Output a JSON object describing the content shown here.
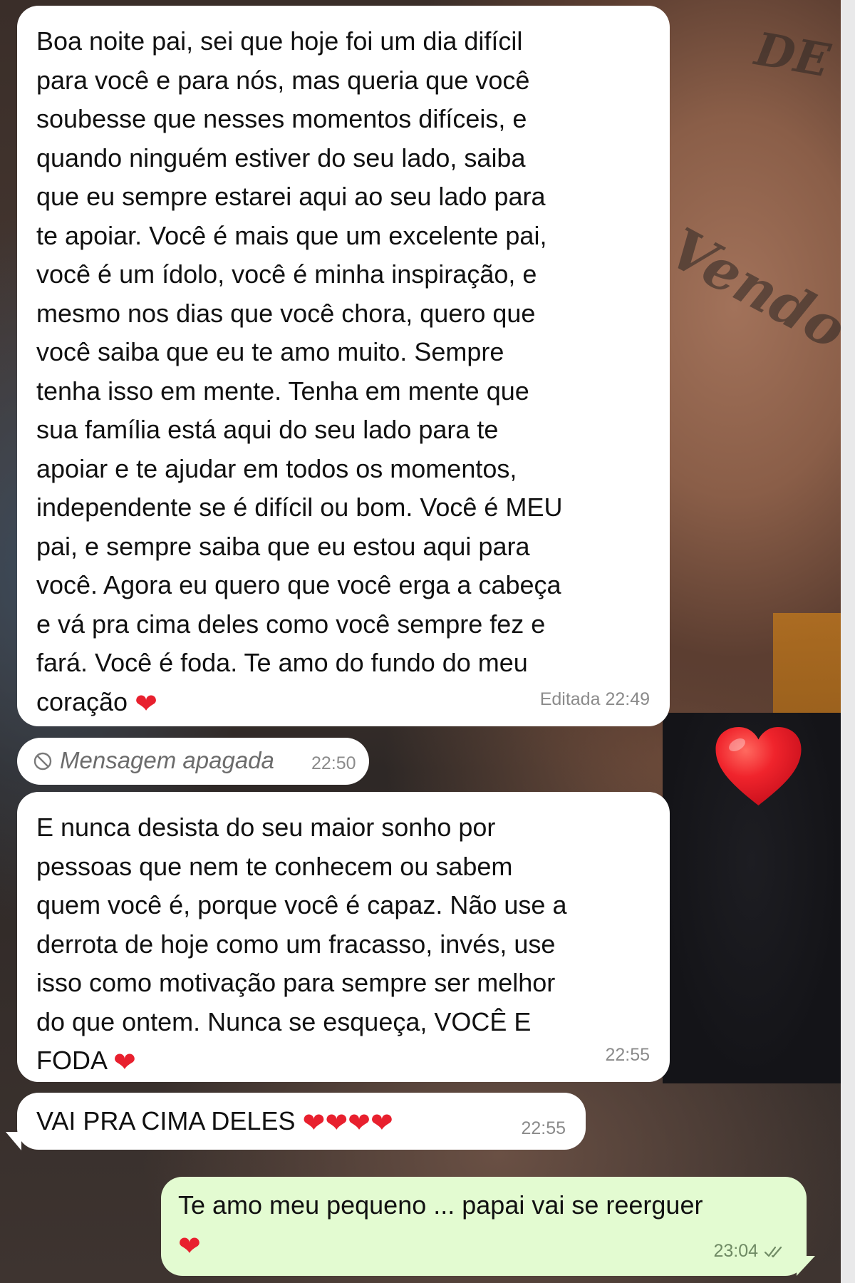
{
  "messages": [
    {
      "lines": [
        "Boa noite pai, sei que hoje foi um dia difícil",
        "para você e para nós, mas queria que você",
        "soubesse que nesses momentos difíceis, e",
        "quando ninguém estiver do seu lado, saiba",
        "que eu sempre estarei aqui ao seu lado para",
        "te apoiar. Você é mais que um excelente pai,",
        "você é um ídolo, você é minha inspiração, e",
        "mesmo nos dias que você chora, quero que",
        "você saiba que eu te amo muito. Sempre",
        "tenha isso em mente. Tenha em mente que",
        "sua família está aqui do seu lado para te",
        "apoiar e te ajudar em todos os momentos,",
        "independente se é difícil ou bom. Você é MEU",
        "pai, e sempre saiba que eu estou aqui para",
        "você. Agora eu quero que você erga a cabeça",
        "e vá pra cima deles como você sempre fez e",
        "fará. Você é foda. Te amo do fundo do meu",
        "coração ❤"
      ],
      "meta": "Editada 22:49"
    },
    {
      "text": "Mensagem apagada",
      "time": "22:50"
    },
    {
      "lines": [
        "E nunca desista do seu maior sonho por",
        "pessoas que nem te conhecem ou sabem",
        "quem você é, porque você é capaz. Não use a",
        "derrota de hoje como um fracasso, invés, use",
        "isso como motivação para sempre ser melhor",
        "do que ontem. Nunca se esqueça, VOCÊ E",
        "FODA ❤"
      ],
      "time": "22:55"
    },
    {
      "text": "VAI PRA CIMA DELES ❤❤❤❤",
      "time": "22:55"
    },
    {
      "lines": [
        "Te amo meu pequeno ... papai vai se reerguer",
        "❤"
      ],
      "time": "23:04",
      "status_icon": "double-check-icon"
    }
  ],
  "reaction": "❤",
  "colors": {
    "incoming_bubble": "#ffffff",
    "outgoing_bubble": "#e3fbd1",
    "heart": "#e8202e",
    "meta_text": "#8b8b8b"
  }
}
